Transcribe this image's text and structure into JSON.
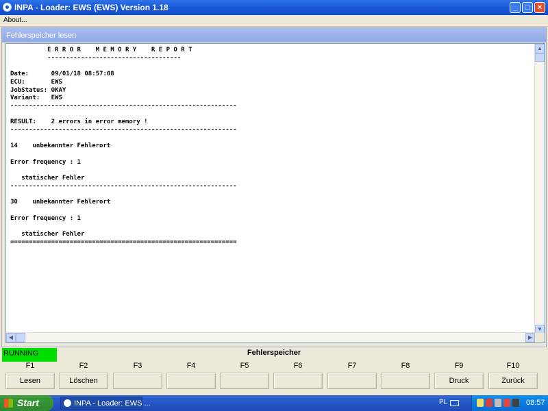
{
  "window": {
    "title": "INPA - Loader:  EWS (EWS) Version 1.18",
    "min_symbol": "_",
    "max_symbol": "□",
    "close_symbol": "×"
  },
  "menu": {
    "about": "About..."
  },
  "panel": {
    "title": "Fehlerspeicher lesen"
  },
  "report": {
    "lines": [
      "          E R R O R    M E M O R Y    R E P O R T",
      "          ------------------------------------",
      "",
      "Date:      09/01/18 08:57:08",
      "ECU:       EWS",
      "JobStatus: OKAY",
      "Variant:   EWS",
      "-------------------------------------------------------------",
      "",
      "RESULT:    2 errors in error memory !",
      "-------------------------------------------------------------",
      "",
      "14    unbekannter Fehlerort",
      "",
      "Error frequency : 1",
      "",
      "   statischer Fehler",
      "-------------------------------------------------------------",
      "",
      "30    unbekannter Fehlerort",
      "",
      "Error frequency : 1",
      "",
      "   statischer Fehler",
      "============================================================="
    ]
  },
  "status": {
    "badge": "RUNNING",
    "title": "Fehlerspeicher",
    "badge_color": "#00e000"
  },
  "fkeys": [
    {
      "key": "F1",
      "label": "Lesen"
    },
    {
      "key": "F2",
      "label": "Löschen"
    },
    {
      "key": "F3",
      "label": ""
    },
    {
      "key": "F4",
      "label": ""
    },
    {
      "key": "F5",
      "label": ""
    },
    {
      "key": "F6",
      "label": ""
    },
    {
      "key": "F7",
      "label": ""
    },
    {
      "key": "F8",
      "label": ""
    },
    {
      "key": "F9",
      "label": "Druck"
    },
    {
      "key": "F10",
      "label": "Zurück"
    }
  ],
  "taskbar": {
    "start": "Start",
    "task": "INPA - Loader:  EWS ...",
    "lang": "PL",
    "time": "08:57"
  }
}
